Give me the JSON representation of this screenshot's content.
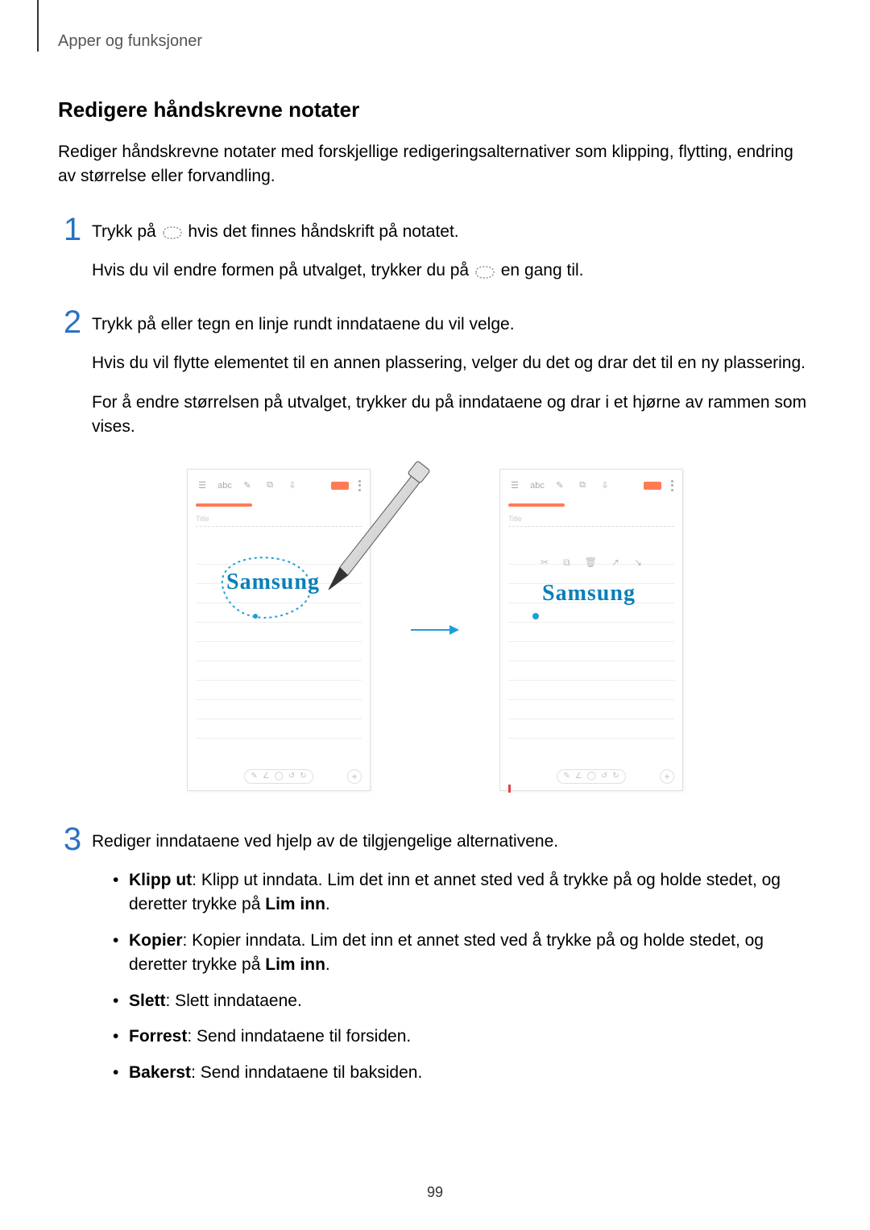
{
  "breadcrumb": "Apper og funksjoner",
  "section_title": "Redigere håndskrevne notater",
  "intro": "Rediger håndskrevne notater med forskjellige redigeringsalternativer som klipping, flytting, endring av størrelse eller forvandling.",
  "steps": {
    "s1_a": "Trykk på ",
    "s1_b": " hvis det finnes håndskrift på notatet.",
    "s1_c": "Hvis du vil endre formen på utvalget, trykker du på ",
    "s1_d": " en gang til.",
    "s2_a": "Trykk på eller tegn en linje rundt inndataene du vil velge.",
    "s2_b": "Hvis du vil flytte elementet til en annen plassering, velger du det og drar det til en ny plassering.",
    "s2_c": "For å endre størrelsen på utvalget, trykker du på inndataene og drar i et hjørne av rammen som vises.",
    "s3_a": "Rediger inndataene ved hjelp av de tilgjengelige alternativene."
  },
  "bullets": {
    "b1_label": "Klipp ut",
    "b1_text": ": Klipp ut inndata. Lim det inn et annet sted ved å trykke på og holde stedet, og deretter trykke på ",
    "b1_end": ".",
    "paste_label": "Lim inn",
    "b2_label": "Kopier",
    "b2_text": ": Kopier inndata. Lim det inn et annet sted ved å trykke på og holde stedet, og deretter trykke på ",
    "b2_end": ".",
    "b3_label": "Slett",
    "b3_text": ": Slett inndataene.",
    "b4_label": "Forrest",
    "b4_text": ": Send inndataene til forsiden.",
    "b5_label": "Bakerst",
    "b5_text": ": Send inndataene til baksiden."
  },
  "illus": {
    "title_placeholder": "Title",
    "toolbar_icons": [
      "☰",
      "abc",
      "✎",
      "⧉",
      "⇩"
    ],
    "handwriting_left": "Samsung",
    "handwriting_right": "Samsung",
    "context_icons": [
      "✂",
      "⧉",
      "🗑",
      "↗",
      "↘"
    ],
    "bottom_pill_icons": [
      "✎",
      "∠",
      "◯",
      "↺",
      "↻"
    ]
  },
  "page_number": "99"
}
